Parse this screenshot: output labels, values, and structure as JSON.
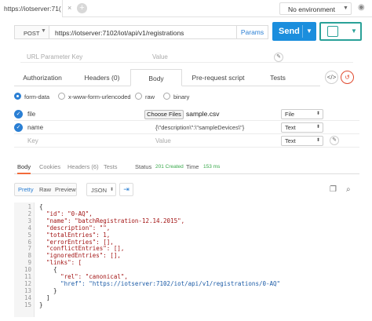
{
  "tab": {
    "label": "https://iotserver:71(",
    "close": "×",
    "add": "+"
  },
  "environment": {
    "selected": "No environment"
  },
  "request": {
    "method": "POST",
    "url": "https://iotserver:7102/iot/api/v1/registrations",
    "params_label": "Params",
    "send_label": "Send"
  },
  "url_params": {
    "key_placeholder": "URL Parameter Key",
    "value_placeholder": "Value"
  },
  "request_tabs": [
    {
      "label": "Authorization",
      "active": false
    },
    {
      "label": "Headers (0)",
      "active": false
    },
    {
      "label": "Body",
      "active": true
    },
    {
      "label": "Pre-request script",
      "active": false
    },
    {
      "label": "Tests",
      "active": false
    }
  ],
  "body_types": [
    {
      "label": "form-data",
      "selected": true
    },
    {
      "label": "x-www-form-urlencoded",
      "selected": false
    },
    {
      "label": "raw",
      "selected": false
    },
    {
      "label": "binary",
      "selected": false
    }
  ],
  "form_rows": [
    {
      "key": "file",
      "choose_label": "Choose Files",
      "value": "sample.csv",
      "type": "File"
    },
    {
      "key": "name",
      "value": "{\\\"description\\\":\\\"sampleDevices\\\"}",
      "type": "Text"
    },
    {
      "key": "Key",
      "value": "Value",
      "type": "Text"
    }
  ],
  "response_tabs": [
    {
      "label": "Body",
      "active": true
    },
    {
      "label": "Cookies",
      "active": false
    },
    {
      "label": "Headers (6)",
      "active": false
    },
    {
      "label": "Tests",
      "active": false
    }
  ],
  "status": {
    "status_label": "Status",
    "status_value": "201 Created",
    "time_label": "Time",
    "time_value": "153 ms"
  },
  "view_modes": [
    {
      "label": "Pretty",
      "active": true
    },
    {
      "label": "Raw",
      "active": false
    },
    {
      "label": "Preview",
      "active": false
    }
  ],
  "format": {
    "selected": "JSON"
  },
  "response_body": [
    {
      "n": "1",
      "text": "{"
    },
    {
      "n": "2",
      "text": "  \"id\": \"0-AQ\","
    },
    {
      "n": "3",
      "text": "  \"name\": \"batchRegistration-12.14.2015\","
    },
    {
      "n": "4",
      "text": "  \"description\": \"\","
    },
    {
      "n": "5",
      "text": "  \"totalEntries\": 1,"
    },
    {
      "n": "6",
      "text": "  \"errorEntries\": [],"
    },
    {
      "n": "7",
      "text": "  \"conflictEntries\": [],"
    },
    {
      "n": "8",
      "text": "  \"ignoredEntries\": [],"
    },
    {
      "n": "9",
      "text": "  \"links\": ["
    },
    {
      "n": "10",
      "text": "    {"
    },
    {
      "n": "11",
      "text": "      \"rel\": \"canonical\","
    },
    {
      "n": "12",
      "text": "      \"href\": \"https://iotserver:7102/iot/api/v1/registrations/0-AQ\""
    },
    {
      "n": "13",
      "text": "    }"
    },
    {
      "n": "14",
      "text": "  ]"
    },
    {
      "n": "15",
      "text": "}"
    }
  ],
  "colors": {
    "send": "#1b8edd",
    "save": "#2aa198",
    "link": "#2a7fd4",
    "status_ok": "#38a84a",
    "active_tab_underline": "#f26b3a"
  }
}
